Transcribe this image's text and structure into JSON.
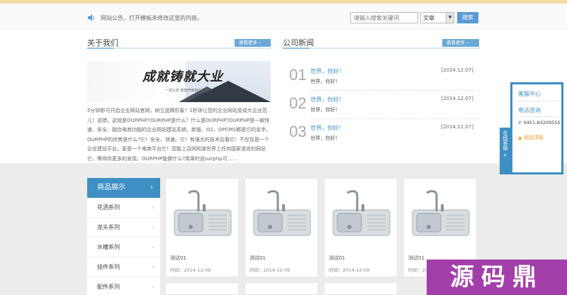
{
  "notice": {
    "text": "网站公告，打开模板未修改这里的内容。"
  },
  "search": {
    "placeholder": "请输入搜索关键词",
    "category": "文章",
    "button": "搜索"
  },
  "about": {
    "title": "关于我们",
    "more": "查看更多",
    "banner_slogan": "成就铸就大业",
    "banner_sub": "一百九年 助你开启商业之旅",
    "paragraph": "5分钟即可开启企业网站官网，树立品牌形象！1秒钟让您的企业网站变成大企业范儿！说错，这就是OURPHP?OURPHP是什么？什么是OURPHP?OURPHP是一款快速、安全、融合电商功能的企业网站建站系统，新版、O2、OPCMS都是它的名字，OURPHP的优势是什么?它！安全，快速。它！有强大的技术后盾它！不仅仅是一个企业建站平台，更是一个电商平台它！您能上百网知道世界上任何国家语言的网站它，等待你更多的发现。OURPHP能做什么?简单的说ourphp可……"
  },
  "news": {
    "title": "公司新闻",
    "more": "查看更多",
    "items": [
      {
        "num": "01",
        "title": "世界，你好！",
        "sub": "世界，你好！",
        "date": "[2014.12.07]"
      },
      {
        "num": "02",
        "title": "世界，你好！",
        "sub": "世界，你好！",
        "date": "[2014.12.07]"
      },
      {
        "num": "03",
        "title": "世界，你好！",
        "sub": "世界，你好！",
        "date": "[2014.12.07]"
      }
    ]
  },
  "products": {
    "header": "商品展示",
    "categories": [
      "花洒系列",
      "龙头系列",
      "水槽系列",
      "挂件系列",
      "配件系列"
    ],
    "cards": [
      {
        "name": "测试01",
        "time": "时间：2014-12-09"
      },
      {
        "name": "测试01",
        "time": "时间：2014-12-09"
      },
      {
        "name": "测试01",
        "time": "时间：2014-12-09"
      },
      {
        "name": "测试01",
        "time": "时间：2014-12-09"
      }
    ]
  },
  "float": {
    "tab": "在线客服",
    "title": "客服中心",
    "consult": "电话咨询",
    "phone": "0451-83209555",
    "to_top": "返回顶部"
  },
  "watermark": "源码鼎",
  "colors": {
    "accent": "#3d8fc4",
    "topbar": "#f3d9a4",
    "watermark": "#a23ea9"
  }
}
